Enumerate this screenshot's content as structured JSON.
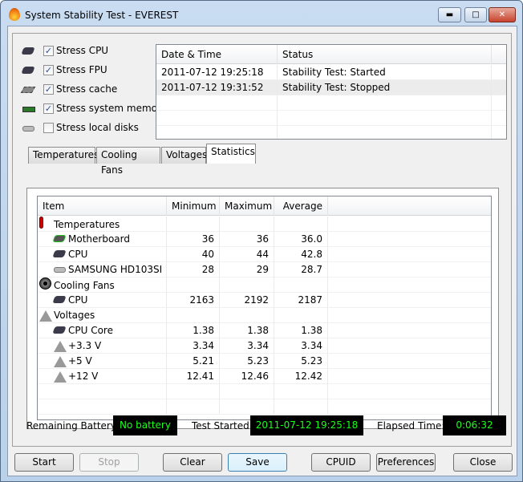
{
  "window": {
    "title": "System Stability Test - EVEREST",
    "icon": "flame-icon"
  },
  "stress": [
    {
      "label": "Stress CPU",
      "checked": true,
      "icon": "cpu-icon"
    },
    {
      "label": "Stress FPU",
      "checked": true,
      "icon": "fpu-icon"
    },
    {
      "label": "Stress cache",
      "checked": true,
      "icon": "cache-chip-icon"
    },
    {
      "label": "Stress system memory",
      "checked": true,
      "icon": "memory-icon"
    },
    {
      "label": "Stress local disks",
      "checked": false,
      "icon": "disk-icon"
    }
  ],
  "log": {
    "columns": [
      "Date & Time",
      "Status"
    ],
    "rows": [
      [
        "2011-07-12 19:25:18",
        "Stability Test: Started"
      ],
      [
        "2011-07-12 19:31:52",
        "Stability Test: Stopped"
      ]
    ]
  },
  "tabs": [
    {
      "label": "Temperatures"
    },
    {
      "label": "Cooling Fans"
    },
    {
      "label": "Voltages"
    },
    {
      "label": "Statistics",
      "selected": true
    }
  ],
  "stats": {
    "columns": [
      "Item",
      "Minimum",
      "Maximum",
      "Average"
    ],
    "rows": [
      {
        "item": "Temperatures",
        "group": true,
        "icon": "thermometer-icon"
      },
      {
        "item": "Motherboard",
        "min": "36",
        "max": "36",
        "avg": "36.0",
        "icon": "motherboard-icon"
      },
      {
        "item": "CPU",
        "min": "40",
        "max": "44",
        "avg": "42.8",
        "icon": "cpu-icon"
      },
      {
        "item": "SAMSUNG HD103SI",
        "min": "28",
        "max": "29",
        "avg": "28.7",
        "icon": "disk-icon"
      },
      {
        "item": "Cooling Fans",
        "group": true,
        "icon": "fan-icon"
      },
      {
        "item": "CPU",
        "min": "2163",
        "max": "2192",
        "avg": "2187",
        "icon": "cpu-icon"
      },
      {
        "item": "Voltages",
        "group": true,
        "icon": "voltage-icon"
      },
      {
        "item": "CPU Core",
        "min": "1.38",
        "max": "1.38",
        "avg": "1.38",
        "icon": "cpu-icon"
      },
      {
        "item": "+3.3 V",
        "min": "3.34",
        "max": "3.34",
        "avg": "3.34",
        "icon": "voltage-icon"
      },
      {
        "item": "+5 V",
        "min": "5.21",
        "max": "5.23",
        "avg": "5.23",
        "icon": "voltage-icon"
      },
      {
        "item": "+12 V",
        "min": "12.41",
        "max": "12.46",
        "avg": "12.42",
        "icon": "voltage-icon"
      }
    ]
  },
  "status": {
    "battery_label": "Remaining Battery:",
    "battery": "No battery",
    "started_label": "Test Started:",
    "started": "2011-07-12 19:25:18",
    "elapsed_label": "Elapsed Time:",
    "elapsed": "0:06:32",
    "led_color": "#1aff1a"
  },
  "buttons": {
    "start": "Start",
    "stop": "Stop",
    "clear": "Clear",
    "save": "Save",
    "cpuid": "CPUID",
    "preferences": "Preferences",
    "close": "Close"
  }
}
